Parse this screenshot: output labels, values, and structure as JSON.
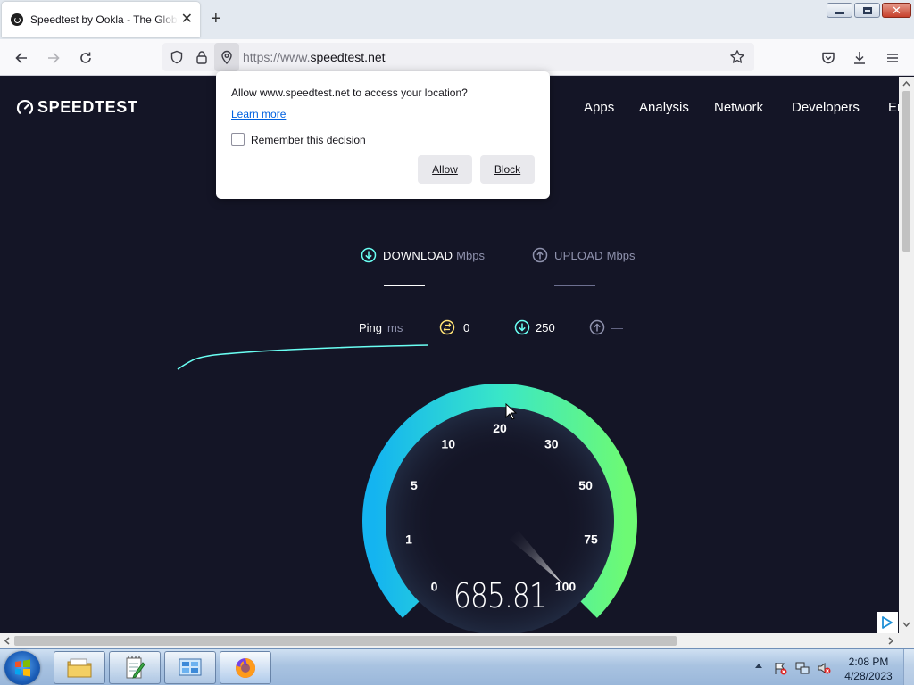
{
  "browser": {
    "tab_title": "Speedtest by Ookla - The Global Broadband Speed Test",
    "url_prefix": "https://www.",
    "url_domain": "speedtest.net"
  },
  "popup": {
    "message": "Allow www.speedtest.net to access your location?",
    "learn_more": "Learn more",
    "remember_label": "Remember this decision",
    "remember_checked": false,
    "allow_label": "Allow",
    "block_label": "Block"
  },
  "site": {
    "logo_text": "SPEEDTEST",
    "nav": [
      "Apps",
      "Analysis",
      "Network",
      "Developers",
      "Enterprise"
    ]
  },
  "test": {
    "download_label": "DOWNLOAD",
    "upload_label": "UPLOAD",
    "unit": "Mbps",
    "ping_label": "Ping",
    "ping_unit": "ms",
    "ping_idle": "0",
    "ping_download": "250",
    "ping_upload": "—",
    "current_speed": "685.81",
    "needle_value": 685.81
  },
  "gauge": {
    "ticks": [
      "0",
      "1",
      "5",
      "10",
      "20",
      "30",
      "50",
      "75",
      "100"
    ],
    "colors": {
      "start": "#14b4f0",
      "mid": "#39e6c8",
      "end": "#6dfa74"
    }
  },
  "taskbar": {
    "time": "2:08 PM",
    "date": "4/28/2023"
  },
  "colors": {
    "page_bg": "#141526",
    "accent_cyan": "#6afff3",
    "ping_yellow": "#ffe275",
    "muted": "#8f92ad"
  }
}
